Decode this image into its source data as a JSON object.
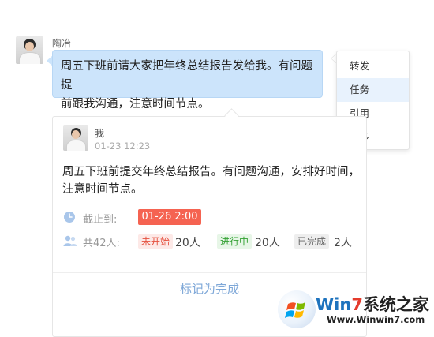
{
  "message": {
    "sender": "陶冶",
    "text_line1": "周五下班前请大家把年终总结报告发给我。有问题提",
    "text_line2": "前跟我沟通，注意时间节点。"
  },
  "context_menu": {
    "items": [
      "转发",
      "任务",
      "引用",
      "更多"
    ],
    "active_index": 1
  },
  "task": {
    "creator": "我",
    "timestamp": "01-23 12:23",
    "text_line1": "周五下班前提交年终总结报告。有问题沟通，安排好时间，",
    "text_line2": "注意时间节点。",
    "deadline_label": "截止到:",
    "deadline_value": "01-26 2:00",
    "assignees_label": "共42人:",
    "status": [
      {
        "label": "未开始",
        "count": "20人"
      },
      {
        "label": "进行中",
        "count": "20人"
      },
      {
        "label": "已完成",
        "count": "2人"
      }
    ],
    "mark_done_label": "标记为完成"
  },
  "watermark": {
    "title_win": "Win",
    "title_7": "7",
    "title_rest": "系统之家",
    "url": "Www.Winwin7.com"
  },
  "colors": {
    "bubble": "#cce4fb",
    "deadline_badge": "#f56351",
    "mark_done": "#7fa8d8",
    "menu_active": "#e8f2fd"
  },
  "icons": [
    "clock-icon",
    "people-icon",
    "windows-logo-icon"
  ]
}
